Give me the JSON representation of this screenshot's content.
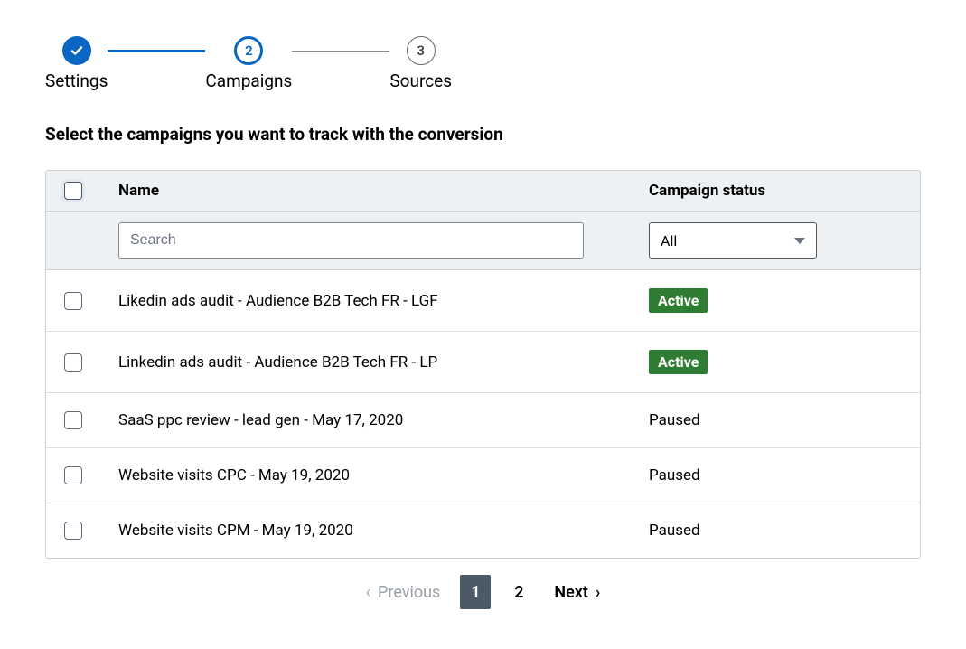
{
  "stepper": {
    "steps": [
      {
        "label": "Settings",
        "state": "done"
      },
      {
        "label": "Campaigns",
        "state": "current",
        "num": "2"
      },
      {
        "label": "Sources",
        "state": "future",
        "num": "3"
      }
    ]
  },
  "heading": "Select the campaigns you want to track with the conversion",
  "table": {
    "columns": {
      "name": "Name",
      "status": "Campaign status"
    },
    "filters": {
      "search_placeholder": "Search",
      "status_value": "All"
    },
    "rows": [
      {
        "name": "Likedin ads audit - Audience B2B Tech FR - LGF",
        "status": "Active",
        "badge": true
      },
      {
        "name": "Linkedin ads audit - Audience B2B Tech FR - LP",
        "status": "Active",
        "badge": true
      },
      {
        "name": "SaaS ppc review - lead gen - May 17, 2020",
        "status": "Paused",
        "badge": false
      },
      {
        "name": "Website visits CPC - May 19, 2020",
        "status": "Paused",
        "badge": false
      },
      {
        "name": "Website visits CPM - May 19, 2020",
        "status": "Paused",
        "badge": false
      }
    ]
  },
  "pager": {
    "prev": "Previous",
    "next": "Next",
    "pages": [
      "1",
      "2"
    ],
    "current": "1"
  }
}
